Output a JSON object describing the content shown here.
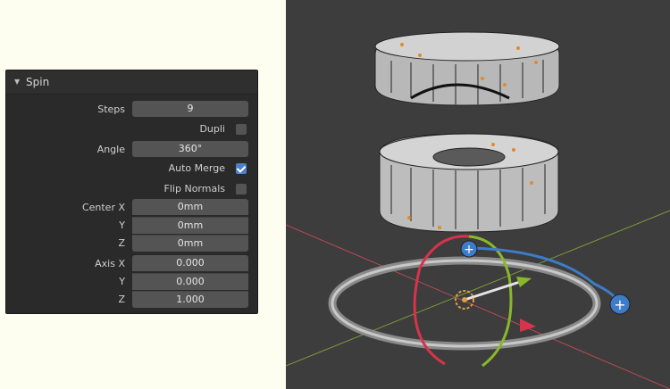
{
  "panel": {
    "title": "Spin",
    "steps": {
      "label": "Steps",
      "value": "9"
    },
    "dupli": {
      "label": "Dupli",
      "checked": false
    },
    "angle": {
      "label": "Angle",
      "value": "360°"
    },
    "auto_merge": {
      "label": "Auto Merge",
      "checked": true
    },
    "flip_normals": {
      "label": "Flip Normals",
      "checked": false
    },
    "center": {
      "x_label": "Center X",
      "x": "0mm",
      "y_label": "Y",
      "y": "0mm",
      "z_label": "Z",
      "z": "0mm"
    },
    "axis": {
      "x_label": "Axis X",
      "x": "0.000",
      "y_label": "Y",
      "y": "0.000",
      "z_label": "Z",
      "z": "1.000"
    }
  },
  "colors": {
    "checkbox_on": "#4f80c7",
    "viewport_bg": "#3d3d3d",
    "gizmo_red": "#d8334c",
    "gizmo_green": "#8ab82b",
    "gizmo_blue": "#3d7cc9",
    "selection_orange": "#e08a2c"
  }
}
